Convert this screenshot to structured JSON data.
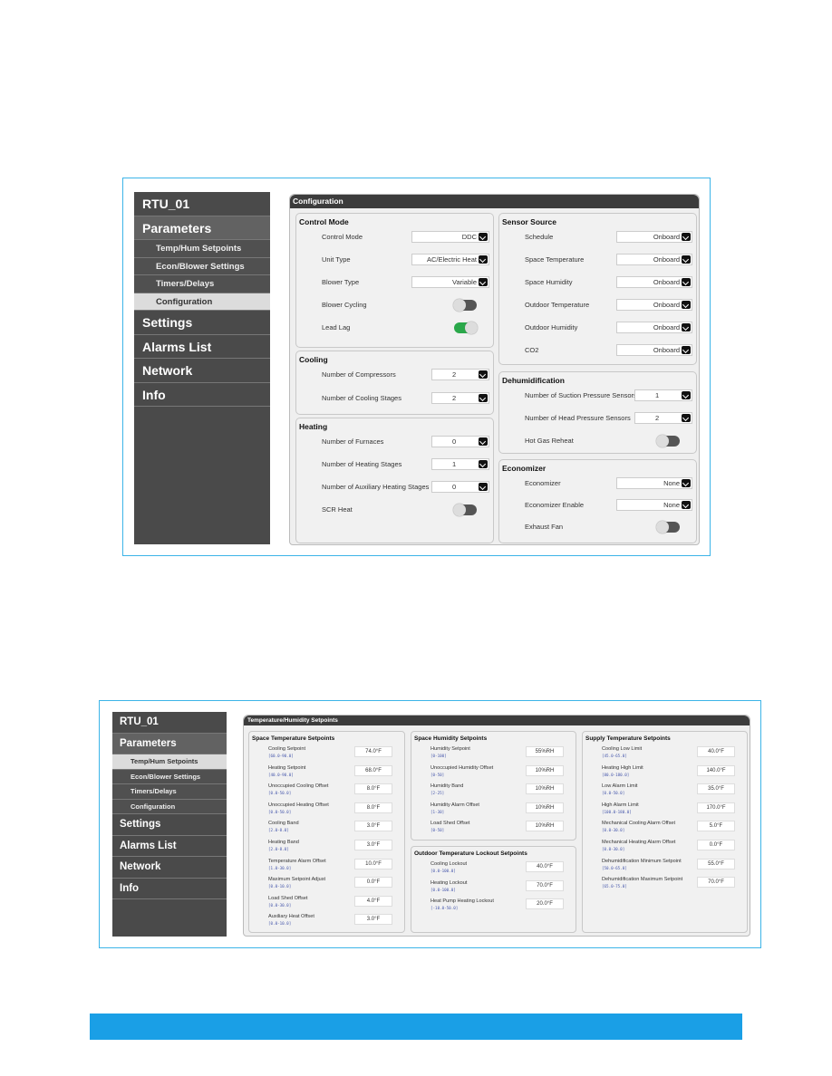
{
  "colors": {
    "frame": "#3cb4e8",
    "footer": "#1a9fe6",
    "toggle_on": "#2aa84a",
    "sidebar": "#4a4a4a"
  },
  "screen1": {
    "sidebar": [
      {
        "label": "RTU_01",
        "type": "top"
      },
      {
        "label": "Parameters",
        "type": "sel"
      },
      {
        "label": "Temp/Hum Setpoints",
        "type": "sub"
      },
      {
        "label": "Econ/Blower Settings",
        "type": "sub"
      },
      {
        "label": "Timers/Delays",
        "type": "sub"
      },
      {
        "label": "Configuration",
        "type": "act"
      },
      {
        "label": "Settings",
        "type": "top"
      },
      {
        "label": "Alarms List",
        "type": "top"
      },
      {
        "label": "Network",
        "type": "top"
      },
      {
        "label": "Info",
        "type": "top"
      }
    ],
    "title": "Configuration",
    "groups": [
      {
        "title": "Control Mode",
        "rows": [
          {
            "label": "Control Mode",
            "value": "DDC",
            "kind": "select"
          },
          {
            "label": "Unit Type",
            "value": "AC/Electric Heat",
            "kind": "select"
          },
          {
            "label": "Blower Type",
            "value": "Variable",
            "kind": "select"
          },
          {
            "label": "Blower Cycling",
            "kind": "toggle",
            "on": false
          },
          {
            "label": "Lead Lag",
            "kind": "toggle",
            "on": true
          }
        ]
      },
      {
        "title": "Cooling",
        "rows": [
          {
            "label": "Number of Compressors",
            "value": "2",
            "kind": "number"
          },
          {
            "label": "Number of Cooling Stages",
            "value": "2",
            "kind": "number"
          }
        ]
      },
      {
        "title": "Heating",
        "rows": [
          {
            "label": "Number of Furnaces",
            "value": "0",
            "kind": "number"
          },
          {
            "label": "Number of Heating Stages",
            "value": "1",
            "kind": "number"
          },
          {
            "label": "Number of Auxiliary Heating Stages",
            "value": "0",
            "kind": "number"
          },
          {
            "label": "SCR Heat",
            "kind": "toggle",
            "on": false
          }
        ]
      },
      {
        "title": "Sensor Source",
        "rows": [
          {
            "label": "Schedule",
            "value": "Onboard",
            "kind": "select"
          },
          {
            "label": "Space Temperature",
            "value": "Onboard",
            "kind": "select"
          },
          {
            "label": "Space Humidity",
            "value": "Onboard",
            "kind": "select"
          },
          {
            "label": "Outdoor Temperature",
            "value": "Onboard",
            "kind": "select"
          },
          {
            "label": "Outdoor Humidity",
            "value": "Onboard",
            "kind": "select"
          },
          {
            "label": "CO2",
            "value": "Onboard",
            "kind": "select"
          }
        ]
      },
      {
        "title": "Dehumidification",
        "rows": [
          {
            "label": "Number of Suction Pressure Sensors",
            "value": "1",
            "kind": "number"
          },
          {
            "label": "Number of Head Pressure Sensors",
            "value": "2",
            "kind": "number"
          },
          {
            "label": "Hot Gas Reheat",
            "kind": "toggle",
            "on": false
          }
        ]
      },
      {
        "title": "Economizer",
        "rows": [
          {
            "label": "Economizer",
            "value": "None",
            "kind": "select"
          },
          {
            "label": "Economizer Enable",
            "value": "None",
            "kind": "select"
          },
          {
            "label": "Exhaust Fan",
            "kind": "toggle",
            "on": false
          }
        ]
      }
    ]
  },
  "screen2": {
    "sidebar": [
      {
        "label": "RTU_01",
        "type": "top"
      },
      {
        "label": "Parameters",
        "type": "sel"
      },
      {
        "label": "Temp/Hum Setpoints",
        "type": "act"
      },
      {
        "label": "Econ/Blower Settings",
        "type": "sub"
      },
      {
        "label": "Timers/Delays",
        "type": "sub"
      },
      {
        "label": "Configuration",
        "type": "sub"
      },
      {
        "label": "Settings",
        "type": "top"
      },
      {
        "label": "Alarms List",
        "type": "top"
      },
      {
        "label": "Network",
        "type": "top"
      },
      {
        "label": "Info",
        "type": "top"
      }
    ],
    "title": "Temperature/Humidity Setpoints",
    "groups": [
      {
        "title": "Space Temperature Setpoints",
        "rows": [
          {
            "label": "Cooling Setpoint",
            "range": "[60.0-90.0]",
            "value": "74.0°F"
          },
          {
            "label": "Heating Setpoint",
            "range": "[40.0-90.0]",
            "value": "68.0°F"
          },
          {
            "label": "Unoccupied Cooling Offset",
            "range": "[0.0-50.0]",
            "value": "8.0°F"
          },
          {
            "label": "Unoccupied Heating Offset",
            "range": "[0.0-50.0]",
            "value": "8.0°F"
          },
          {
            "label": "Cooling Band",
            "range": "[2.0-8.0]",
            "value": "3.0°F"
          },
          {
            "label": "Heating Band",
            "range": "[2.0-8.0]",
            "value": "3.0°F"
          },
          {
            "label": "Temperature Alarm Offset",
            "range": "[1.0-30.0]",
            "value": "10.0°F"
          },
          {
            "label": "Maximum Setpoint Adjust",
            "range": "[0.0-10.0]",
            "value": "0.0°F"
          },
          {
            "label": "Load Shed Offset",
            "range": "[0.0-30.0]",
            "value": "4.0°F"
          },
          {
            "label": "Auxiliary Heat Offset",
            "range": "[0.0-10.0]",
            "value": "3.0°F"
          }
        ]
      },
      {
        "title": "Space Humidity Setpoints",
        "rows": [
          {
            "label": "Humidity Setpoint",
            "range": "[0-100]",
            "value": "55%RH"
          },
          {
            "label": "Unoccupied Humidity Offset",
            "range": "[0-50]",
            "value": "10%RH"
          },
          {
            "label": "Humidity Band",
            "range": "[2-25]",
            "value": "10%RH"
          },
          {
            "label": "Humidity Alarm Offset",
            "range": "[1-30]",
            "value": "10%RH"
          },
          {
            "label": "Load Shed Offset",
            "range": "[0-50]",
            "value": "10%RH"
          }
        ]
      },
      {
        "title": "Outdoor Temperature Lockout Setpoints",
        "rows": [
          {
            "label": "Cooling Lockout",
            "range": "[0.0-100.0]",
            "value": "40.0°F"
          },
          {
            "label": "Heating Lockout",
            "range": "[0.0-100.0]",
            "value": "70.0°F"
          },
          {
            "label": "Heat Pump Heating Lockout",
            "range": "[-10.0-50.0]",
            "value": "20.0°F"
          }
        ]
      },
      {
        "title": "Supply Temperature Setpoints",
        "rows": [
          {
            "label": "Cooling Low Limit",
            "range": "[45.0-65.0]",
            "value": "40.0°F"
          },
          {
            "label": "Heating High Limit",
            "range": "[80.0-180.0]",
            "value": "140.0°F"
          },
          {
            "label": "Low Alarm Limit",
            "range": "[0.0-50.0]",
            "value": "35.0°F"
          },
          {
            "label": "High Alarm Limit",
            "range": "[100.0-180.0]",
            "value": "170.0°F"
          },
          {
            "label": "Mechanical Cooling Alarm Offset",
            "range": "[0.0-30.0]",
            "value": "5.0°F"
          },
          {
            "label": "Mechanical Heating Alarm Offset",
            "range": "[0.0-30.0]",
            "value": "0.0°F"
          },
          {
            "label": "Dehumidification Minimum Setpoint",
            "range": "[50.0-65.0]",
            "value": "55.0°F"
          },
          {
            "label": "Dehumidification Maximum Setpoint",
            "range": "[65.0-75.0]",
            "value": "70.0°F"
          }
        ]
      }
    ]
  }
}
